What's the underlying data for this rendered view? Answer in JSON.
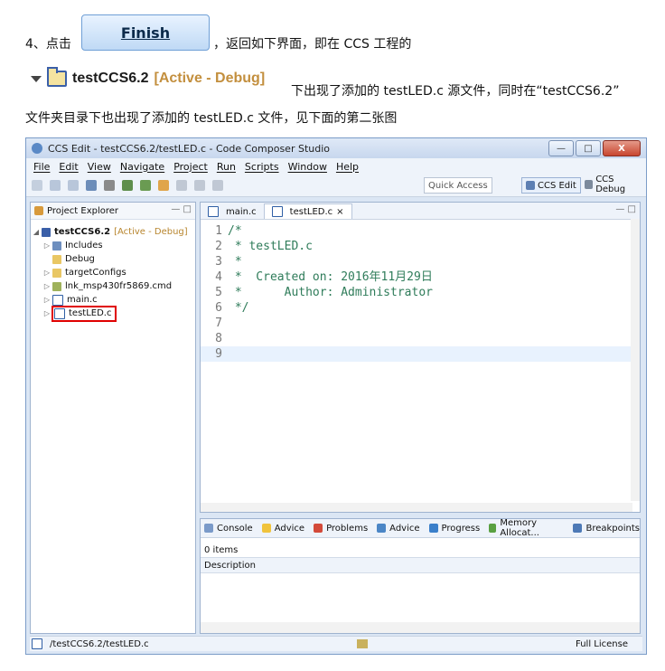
{
  "doc": {
    "step_prefix": "4、点击",
    "finish_label": "Finish",
    "step_suffix": "，返回如下界面，即在 CCS 工程的",
    "proj_name": "testCCS6.2",
    "proj_state": "[Active - Debug]",
    "line2_suffix": "下出现了添加的 testLED.c 源文件，同时在“testCCS6.2”",
    "line3": "文件夹目录下也出现了添加的 testLED.c 文件，见下面的第二张图"
  },
  "window": {
    "title": "CCS Edit - testCCS6.2/testLED.c - Code Composer Studio",
    "controls": {
      "minimize": "—",
      "maximize": "□",
      "close": "X"
    }
  },
  "menu": [
    "File",
    "Edit",
    "View",
    "Navigate",
    "Project",
    "Run",
    "Scripts",
    "Window",
    "Help"
  ],
  "toolbar": {
    "quick_access": "Quick Access",
    "persp_edit": "CCS Edit",
    "persp_debug": "CCS Debug"
  },
  "explorer": {
    "title": "Project Explorer",
    "items": [
      {
        "label": "testCCS6.2",
        "suffix": "[Active - Debug]"
      },
      {
        "label": "Includes"
      },
      {
        "label": "Debug"
      },
      {
        "label": "targetConfigs"
      },
      {
        "label": "lnk_msp430fr5869.cmd"
      },
      {
        "label": "main.c"
      },
      {
        "label": "testLED.c"
      }
    ]
  },
  "editor": {
    "tabs": [
      {
        "label": "main.c"
      },
      {
        "label": "testLED.c"
      }
    ],
    "lines": [
      {
        "num": "1",
        "text": "/*"
      },
      {
        "num": "2",
        "text": " * testLED.c"
      },
      {
        "num": "3",
        "text": " *"
      },
      {
        "num": "4",
        "text": " *  Created on: 2016年11月29日"
      },
      {
        "num": "5",
        "text": " *      Author: Administrator"
      },
      {
        "num": "6",
        "text": " */"
      },
      {
        "num": "7",
        "text": ""
      },
      {
        "num": "8",
        "text": ""
      },
      {
        "num": "9",
        "text": ""
      }
    ]
  },
  "bottom": {
    "tabs": [
      "Console",
      "Advice",
      "Problems",
      "Advice",
      "Progress",
      "Memory Allocat...",
      "Breakpoints"
    ],
    "items": "0 items",
    "column": "Description"
  },
  "status": {
    "path": "/testCCS6.2/testLED.c",
    "license": "Full License"
  }
}
